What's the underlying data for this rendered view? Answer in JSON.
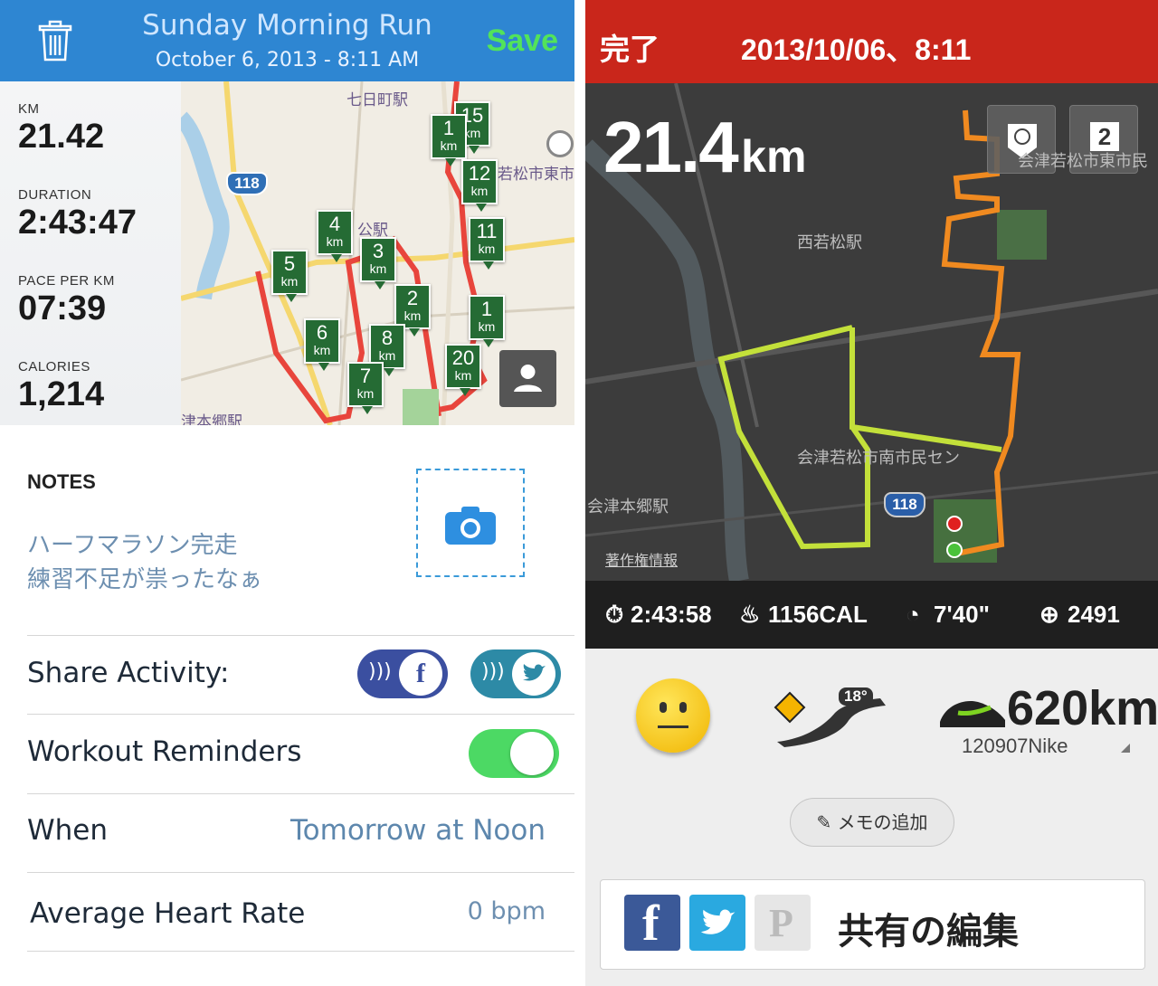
{
  "left": {
    "header": {
      "title": "Sunday Morning Run",
      "subtitle": "October 6, 2013 - 8:11 AM",
      "save_label": "Save"
    },
    "stats": [
      {
        "label": "KM",
        "value": "21.42"
      },
      {
        "label": "DURATION",
        "value": "2:43:47"
      },
      {
        "label": "PACE PER KM",
        "value": "07:39"
      },
      {
        "label": "CALORIES",
        "value": "1,214"
      }
    ],
    "map": {
      "route_label": "118",
      "place_labels": [
        "七日町駅",
        "若松市東市",
        "公駅",
        "津本郷駅"
      ],
      "markers": [
        {
          "n": "15",
          "u": "km"
        },
        {
          "n": "1",
          "u": "km"
        },
        {
          "n": "12",
          "u": "km"
        },
        {
          "n": "4",
          "u": "km"
        },
        {
          "n": "11",
          "u": "km"
        },
        {
          "n": "5",
          "u": "km"
        },
        {
          "n": "3",
          "u": "km"
        },
        {
          "n": "2",
          "u": "km"
        },
        {
          "n": "1",
          "u": "km"
        },
        {
          "n": "6",
          "u": "km"
        },
        {
          "n": "8",
          "u": "km"
        },
        {
          "n": "20",
          "u": "km"
        },
        {
          "n": "7",
          "u": "km"
        }
      ]
    },
    "notes": {
      "heading": "NOTES",
      "lines": [
        "ハーフマラソン完走",
        "練習不足が祟ったなぁ"
      ]
    },
    "rows": {
      "share_label": "Share Activity:",
      "reminders_label": "Workout Reminders",
      "when_label": "When",
      "when_value": "Tomorrow at Noon",
      "hr_label": "Average Heart Rate",
      "hr_value": "0 bpm"
    },
    "colors": {
      "header": "#2e86d2",
      "save": "#52e35a",
      "toggle_on": "#4cd964"
    }
  },
  "right": {
    "header": {
      "done_label": "完了",
      "date": "2013/10/06、8:11"
    },
    "map": {
      "distance": "21.4",
      "distance_unit": "km",
      "button2_label": "2",
      "place_labels": [
        "西若松駅",
        "会津若松市東市民",
        "会津若松市南市民セン",
        "会津本郷駅",
        "著作権情報"
      ],
      "route_label": "118"
    },
    "statbar": {
      "duration": "2:43:58",
      "calories": "1156CAL",
      "pace": "7'40\"",
      "fuel": "2491"
    },
    "shoe": {
      "distance": "620km",
      "name": "120907Nike"
    },
    "weather": {
      "temp": "18°"
    },
    "memo_label": "メモの追加",
    "share_label": "共有の編集",
    "colors": {
      "header": "#c9261b",
      "statbar": "#1f1f1f"
    }
  }
}
